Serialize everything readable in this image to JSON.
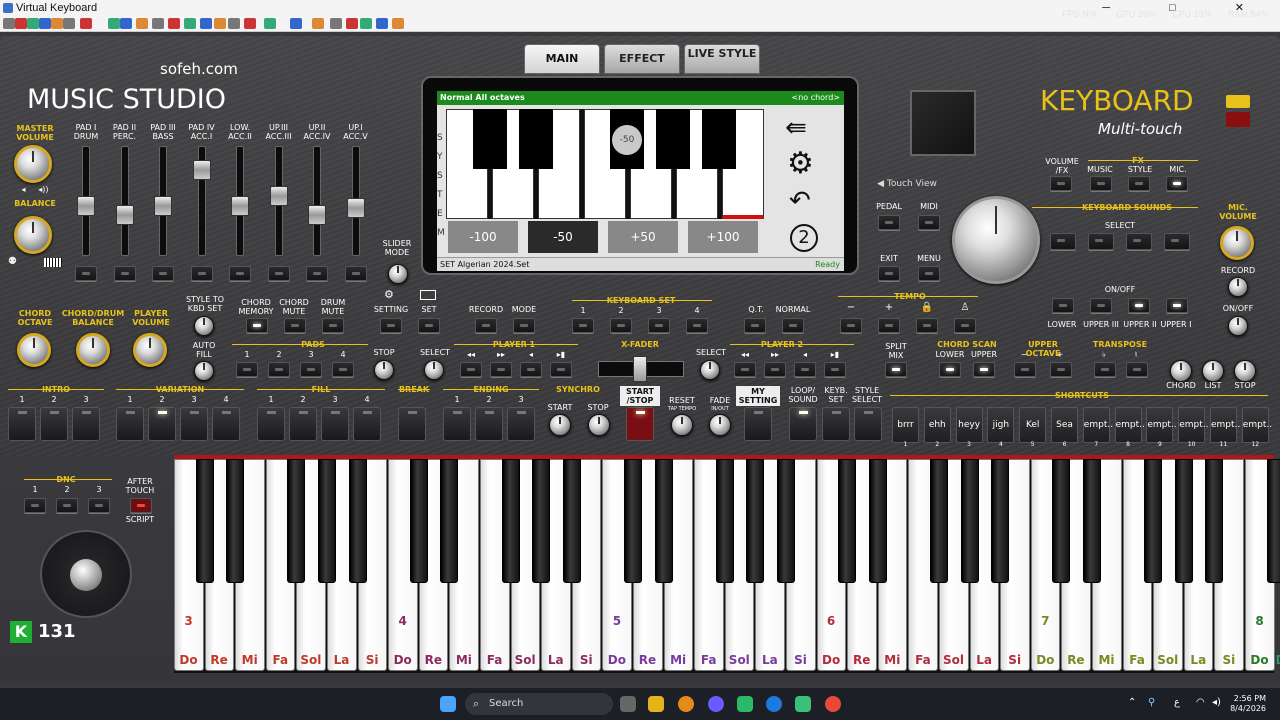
{
  "window": {
    "title": "Virtual Keyboard",
    "controls": "─ □ ✕",
    "perf": [
      "FPS N/A",
      "GPU 26%",
      "CPU 13%",
      "RAM 84%"
    ]
  },
  "brand": {
    "site": "sofeh.com",
    "name": "MUSIC STUDIO",
    "keyboard": "KEYBOARD",
    "sub": "Multi-touch",
    "score_letter": "K",
    "score": "131"
  },
  "tabs": [
    "MAIN",
    "EFFECT",
    "LIVE STYLE"
  ],
  "left": {
    "master": "MASTER VOLUME",
    "balance": "BALANCE"
  },
  "sliders": [
    {
      "label": "PAD I DRUM",
      "level": 0.45
    },
    {
      "label": "PAD II PERC.",
      "level": 0.35
    },
    {
      "label": "PAD III BASS",
      "level": 0.45
    },
    {
      "label": "PAD IV ACC.I",
      "level": 0.85
    },
    {
      "label": "LOW. ACC.II",
      "level": 0.45
    },
    {
      "label": "UP.III ACC.III",
      "level": 0.55
    },
    {
      "label": "UP.II ACC.IV",
      "level": 0.35
    },
    {
      "label": "UP.I ACC.V",
      "level": 0.42
    }
  ],
  "slider_mode": "SLIDER MODE",
  "display": {
    "header": "Normal All octaves",
    "chord": "<no chord>",
    "side_letters": [
      "S",
      "Y",
      "S",
      "T",
      "E",
      "M"
    ],
    "marker": "-50",
    "presets": [
      "-100",
      "-50",
      "+50",
      "+100"
    ],
    "footer": "SET Algerian 2024.Set",
    "status": "Ready",
    "badge": "2"
  },
  "right_top": {
    "touch_view": "◀ Touch View",
    "pedal": "PEDAL",
    "midi": "MIDI",
    "exit": "EXIT",
    "menu": "MENU",
    "volume_fx": "VOLUME /FX",
    "fx": "FX",
    "music": "MUSIC",
    "style": "STYLE",
    "mic": "MIC.",
    "keyboard_sounds": "KEYBOARD SOUNDS",
    "select": "SELECT",
    "onoff": "ON/OFF",
    "sound_labels": [
      "LOWER",
      "UPPER III",
      "UPPER II",
      "UPPER I"
    ],
    "mic_volume": "MIC. VOLUME",
    "record": "RECORD",
    "mic_onoff": "ON/OFF"
  },
  "mid_row": {
    "chord_octave": "CHORD OCTAVE",
    "balance": "CHORD/DRUM BALANCE",
    "player_volume": "PLAYER VOLUME",
    "style_to_kbd": "STYLE TO KBD SET",
    "chord_memory": "CHORD MEMORY",
    "chord_mute": "CHORD MUTE",
    "drum_mute": "DRUM MUTE",
    "setting": "SETTING",
    "set": "SET",
    "record": "RECORD",
    "mode": "MODE",
    "keyboard_set": "KEYBOARD SET",
    "kset": [
      "1",
      "2",
      "3",
      "4"
    ],
    "qt": "Q.T.",
    "normal": "NORMAL",
    "tempo": "TEMPO",
    "tempo_labels": [
      "−",
      "+",
      "🔒",
      "♙"
    ],
    "auto_fill": "AUTO FILL",
    "pads": "PADS",
    "pad_nums": [
      "1",
      "2",
      "3",
      "4"
    ],
    "stop": "STOP",
    "select": "SELECT",
    "player1": "PLAYER 1",
    "xfader": "X-FADER",
    "player2": "PLAYER 2",
    "split_mix": "SPLIT MIX",
    "chord_scan": "CHORD SCAN",
    "lower": "LOWER",
    "upper": "UPPER",
    "upper_octave": "UPPER OCTAVE",
    "transpose": "TRANSPOSE",
    "minus": "−",
    "plus": "+",
    "flat": "♭",
    "sharp": "♮",
    "chord": "CHORD",
    "list": "LIST",
    "stop2": "STOP"
  },
  "bottom_row": {
    "intro": "INTRO",
    "variation": "VARIATION",
    "fill": "FILL",
    "break": "BREAK",
    "ending": "ENDING",
    "synchro": "SYNCHRO",
    "start": "START",
    "stop": "STOP",
    "start_stop": "START /STOP",
    "reset": "RESET",
    "tap": "TAP TEMPO",
    "fade": "FADE",
    "inout": "IN/OUT",
    "my_setting": "MY SETTING",
    "loop_sound": "LOOP/ SOUND",
    "kbd_set": "KEYB. SET",
    "style_select": "STYLE SELECT",
    "shortcuts_title": "SHORTCUTS",
    "nums3": [
      "1",
      "2",
      "3"
    ],
    "nums4": [
      "1",
      "2",
      "3",
      "4"
    ]
  },
  "shortcuts": [
    {
      "label": "brrr",
      "num": "1"
    },
    {
      "label": "ehh",
      "num": "2"
    },
    {
      "label": "heyy",
      "num": "3"
    },
    {
      "label": "jigh",
      "num": "4"
    },
    {
      "label": "Kel",
      "num": "5"
    },
    {
      "label": "Sea",
      "num": "6"
    },
    {
      "label": "empt..",
      "num": "7"
    },
    {
      "label": "empt..",
      "num": "8"
    },
    {
      "label": "empt..",
      "num": "9"
    },
    {
      "label": "empt..",
      "num": "10"
    },
    {
      "label": "empt..",
      "num": "11"
    },
    {
      "label": "empt..",
      "num": "12"
    }
  ],
  "dnc": {
    "title": "DNC",
    "nums": [
      "1",
      "2",
      "3"
    ],
    "after_touch": "AFTER TOUCH",
    "script": "SCRIPT"
  },
  "notes": [
    "Do",
    "Re",
    "Mi",
    "Fa",
    "Sol",
    "La",
    "Si"
  ],
  "note_colors": [
    "#c0392b",
    "#8e2a5c",
    "#7a3aa0",
    "#b02d3d",
    "#7a8a20",
    "#2a7a2a",
    "#2a9a6a",
    "#2a3a8a"
  ],
  "octaves": [
    "3",
    "4",
    "5",
    "6",
    "7",
    "8"
  ],
  "taskbar": {
    "search": "Search",
    "time": "2:56 PM",
    "date": "8/4/2026",
    "lang": "ع"
  }
}
